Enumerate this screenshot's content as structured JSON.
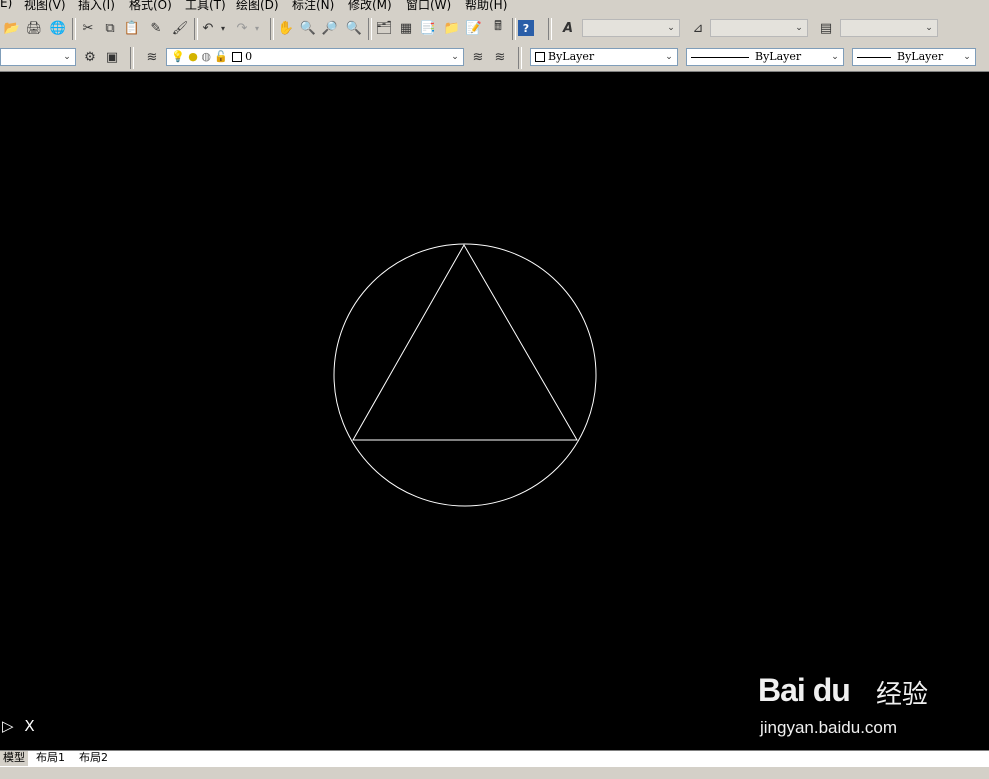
{
  "menubar": {
    "items": [
      "E)",
      "视图(V)",
      "插入(I)",
      "格式(O)",
      "工具(T)",
      "绘图(D)",
      "标注(N)",
      "修改(M)",
      "窗口(W)",
      "帮助(H)"
    ]
  },
  "toolbar2": {
    "layer_value": "0",
    "color_value": "ByLayer",
    "linetype_value": "ByLayer",
    "lineweight_value": "ByLayer"
  },
  "icons": {
    "open": "open-icon",
    "save": "save-icon",
    "cut": "cut-icon",
    "copy": "copy-icon",
    "paste": "paste-icon",
    "matchprop": "brush-icon",
    "undo": "undo-icon",
    "redo": "redo-icon",
    "pan": "pan-icon",
    "zoom": "zoom-icon",
    "properties": "properties-icon",
    "calculator": "calculator-icon",
    "help": "help-icon",
    "text_style": "text-style-icon",
    "dim_style": "dim-style-icon",
    "table_style": "table-style-icon",
    "layer_manager": "layer-icon",
    "bulb": "bulb-icon"
  },
  "drawing": {
    "background": "#000000",
    "stroke": "#ffffff"
  },
  "ucs_icon": {
    "label": "X"
  },
  "watermark": {
    "logo": "Bai du",
    "text": "经验",
    "url": "jingyan.baidu.com"
  },
  "layout_tabs": [
    "模型",
    "布局1",
    "布局2"
  ]
}
